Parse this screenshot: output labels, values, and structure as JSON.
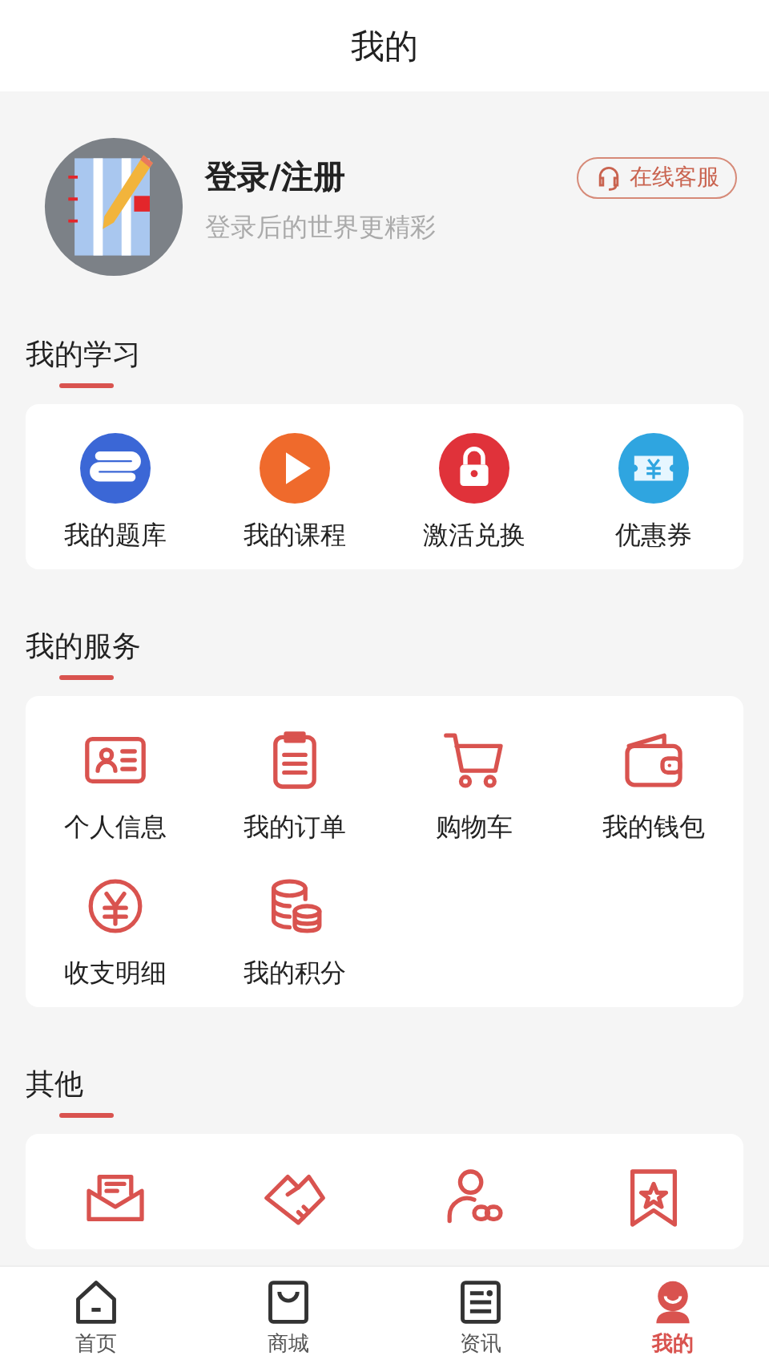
{
  "header": {
    "title": "我的"
  },
  "profile": {
    "name": "登录/注册",
    "subtitle": "登录后的世界更精彩",
    "service_button": "在线客服"
  },
  "sections": [
    {
      "title": "我的学习",
      "items": [
        {
          "kind": "bank",
          "label": "我的题库"
        },
        {
          "kind": "play",
          "label": "我的课程"
        },
        {
          "kind": "lock",
          "label": "激活兑换"
        },
        {
          "kind": "coupon",
          "label": "优惠券"
        }
      ]
    },
    {
      "title": "我的服务",
      "items": [
        {
          "kind": "idcard",
          "label": "个人信息"
        },
        {
          "kind": "clipboard",
          "label": "我的订单"
        },
        {
          "kind": "cart",
          "label": "购物车"
        },
        {
          "kind": "wallet",
          "label": "我的钱包"
        },
        {
          "kind": "yuan",
          "label": "收支明细"
        },
        {
          "kind": "coins",
          "label": "我的积分"
        }
      ]
    },
    {
      "title": "其他",
      "items": [
        {
          "kind": "mail"
        },
        {
          "kind": "handshake"
        },
        {
          "kind": "userlink"
        },
        {
          "kind": "starbadge"
        }
      ]
    }
  ],
  "tabs": [
    {
      "kind": "home",
      "label": "首页",
      "selected": false
    },
    {
      "kind": "bag",
      "label": "商城",
      "selected": false
    },
    {
      "kind": "news",
      "label": "资讯",
      "selected": false
    },
    {
      "kind": "me",
      "label": "我的",
      "selected": true
    }
  ]
}
